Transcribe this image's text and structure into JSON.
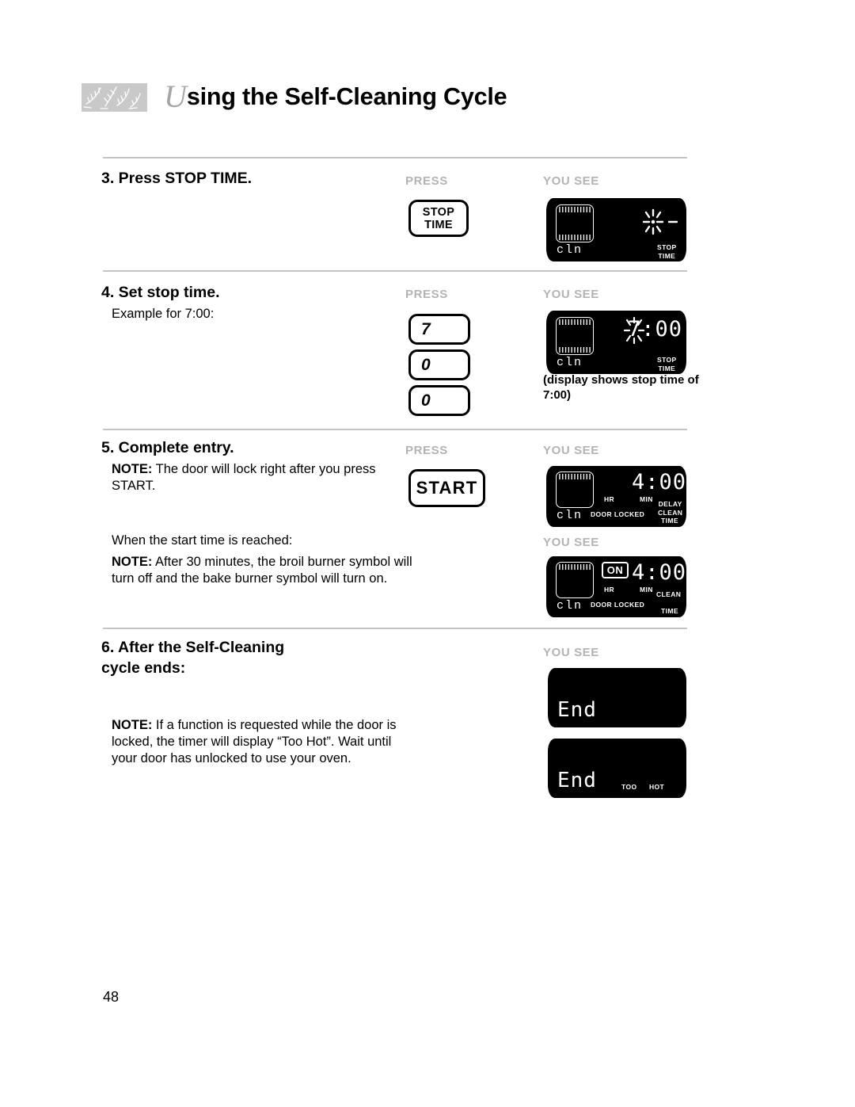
{
  "header": {
    "drop_cap": "U",
    "title_rest": "sing the Self-Cleaning Cycle",
    "ornament_icon": "wheat-sprig-ornament"
  },
  "column_labels": {
    "press": "PRESS",
    "you_see": "YOU SEE"
  },
  "steps": [
    {
      "heading": "3. Press STOP TIME.",
      "body": ""
    },
    {
      "heading": "4. Set stop time.",
      "body": "Example for 7:00:"
    },
    {
      "heading": "5. Complete entry.",
      "note_label": "NOTE:",
      "note_text": " The door will lock right after you press START."
    },
    {
      "heading": "6. After the Self-Cleaning\ncycle ends:",
      "note_label": "NOTE:",
      "note_text": " If a function is requested while the door is locked, the timer will display “Too Hot”. Wait until your door has unlocked to use your oven."
    }
  ],
  "mid_text": {
    "when_start": "When the start time is reached:",
    "note_label": "NOTE:",
    "note_text": " After 30 minutes, the broil burner symbol will turn off and the bake burner symbol will turn on."
  },
  "keys": {
    "stop_time_line1": "STOP",
    "stop_time_line2": "TIME",
    "digit_7": "7",
    "digit_0a": "0",
    "digit_0b": "0",
    "start": "START"
  },
  "displays": [
    {
      "name": "display-stop-time-flashing",
      "cln": "cln",
      "time": "",
      "flashing": true,
      "coils": [
        "top",
        "bottom"
      ],
      "tags": [
        {
          "text": "STOP\nTIME",
          "lines": 2
        }
      ]
    },
    {
      "name": "display-stop-time-700",
      "cln": "cln",
      "time": "7:00",
      "flashing": true,
      "coils": [
        "top",
        "bottom"
      ],
      "tags": [
        {
          "text": "STOP\nTIME",
          "lines": 2
        }
      ],
      "caption": "(display shows stop time of 7:00)"
    },
    {
      "name": "display-delay-clean-400",
      "cln": "cln",
      "time": "4:00",
      "flashing": false,
      "coils": [
        "top"
      ],
      "tags": [
        {
          "text": "HR",
          "lines": 1
        },
        {
          "text": "MIN",
          "lines": 1
        },
        {
          "text": "DOOR LOCKED",
          "lines": 1
        },
        {
          "text": "DELAY\nCLEAN",
          "lines": 2
        },
        {
          "text": "TIME",
          "lines": 1
        }
      ]
    },
    {
      "name": "display-clean-running-400",
      "cln": "cln",
      "time": "4:00",
      "on_badge": "ON",
      "flashing": false,
      "coils": [
        "top"
      ],
      "tags": [
        {
          "text": "HR",
          "lines": 1
        },
        {
          "text": "MIN",
          "lines": 1
        },
        {
          "text": "DOOR LOCKED",
          "lines": 1
        },
        {
          "text": "CLEAN",
          "lines": 1
        },
        {
          "text": "TIME",
          "lines": 1
        }
      ]
    },
    {
      "name": "display-end",
      "end_word": "End",
      "tags": []
    },
    {
      "name": "display-end-too-hot",
      "end_word": "End",
      "tags": [
        {
          "text": "TOO",
          "lines": 1
        },
        {
          "text": "HOT",
          "lines": 1
        }
      ]
    }
  ],
  "page_number": "48",
  "colors": {
    "lcd_background": "#000000",
    "lcd_foreground": "#ffffff",
    "column_label": "#b3b3b3",
    "rule": "#c4c4c4",
    "ornament": "#c9c9c9"
  }
}
